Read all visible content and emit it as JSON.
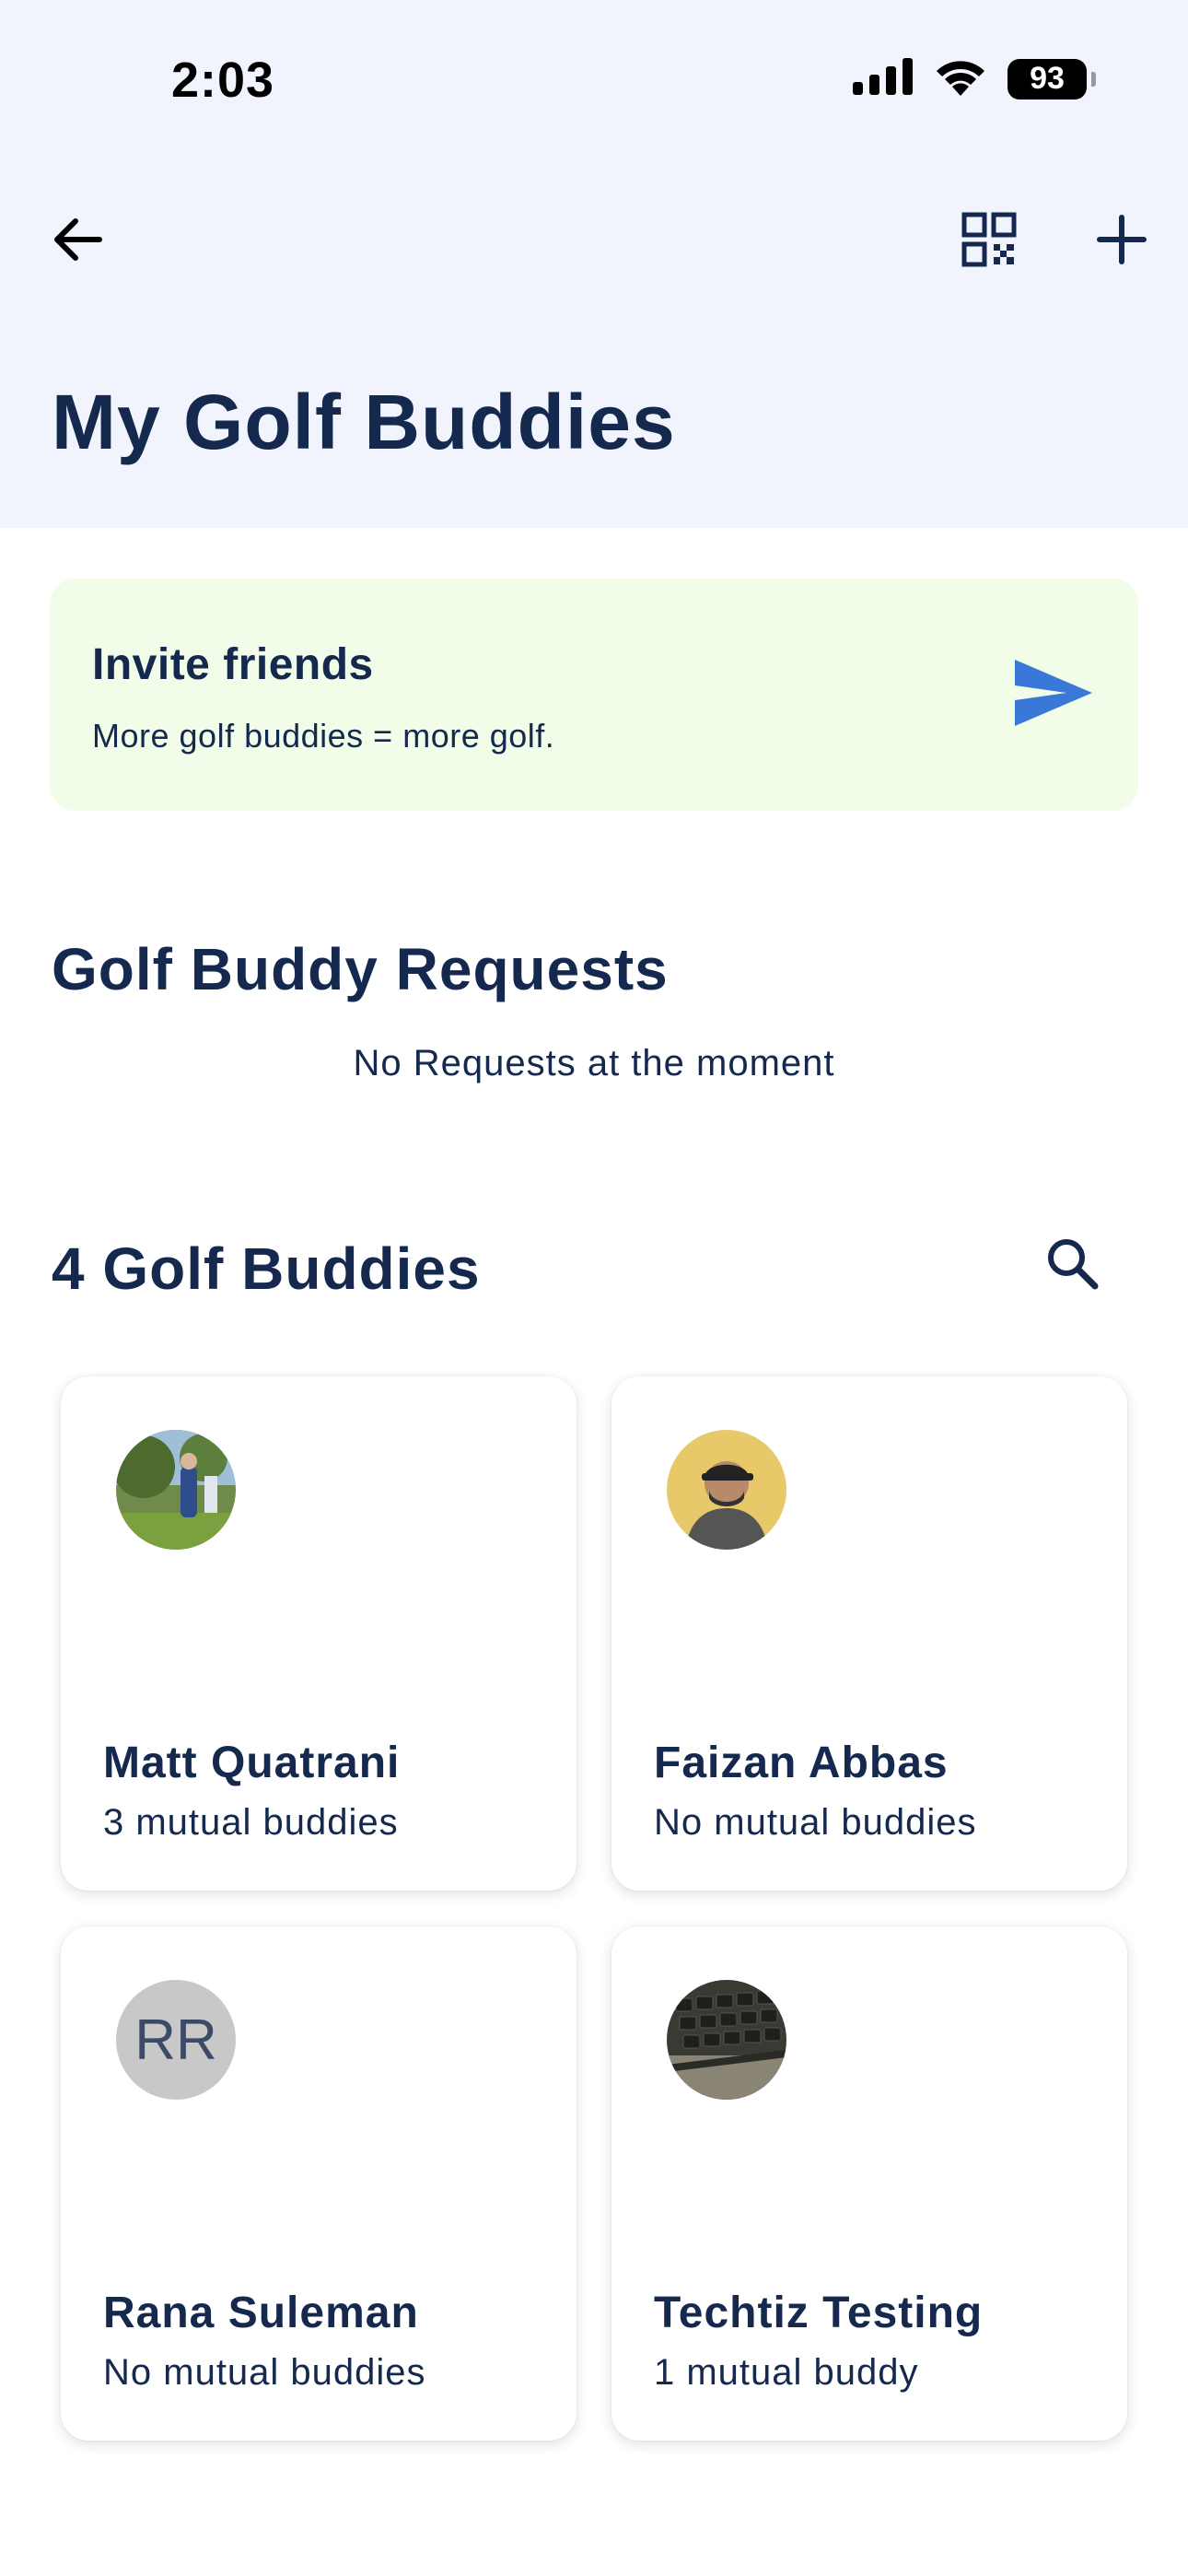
{
  "status_bar": {
    "time": "2:03",
    "battery": "93"
  },
  "nav": {
    "back_icon": "arrow-left-icon",
    "qr_icon": "qr-code-icon",
    "add_icon": "plus-icon"
  },
  "page": {
    "title": "My Golf Buddies"
  },
  "invite": {
    "title": "Invite friends",
    "subtitle": "More golf buddies = more golf.",
    "icon": "send-icon",
    "background": "#f1fde8",
    "icon_color": "#3a78d8"
  },
  "requests": {
    "title": "Golf Buddy Requests",
    "empty_message": "No Requests at the moment"
  },
  "buddies": {
    "title": "4 Golf Buddies",
    "search_icon": "search-icon",
    "items": [
      {
        "name": "Matt Quatrani",
        "mutual": "3 mutual buddies",
        "avatar": "photo"
      },
      {
        "name": "Faizan Abbas",
        "mutual": "No mutual buddies",
        "avatar": "photo"
      },
      {
        "name": "Rana Suleman",
        "mutual": "No mutual buddies",
        "avatar": "initials",
        "initials": "RR"
      },
      {
        "name": "Techtiz Testing",
        "mutual": "1 mutual buddy",
        "avatar": "photo"
      }
    ]
  },
  "colors": {
    "header_bg": "#f1f4fd",
    "text_primary": "#14294d",
    "accent": "#3a78d8"
  }
}
